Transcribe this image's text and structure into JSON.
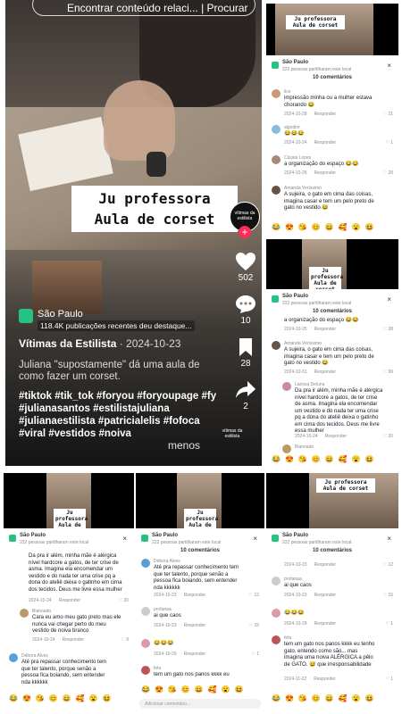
{
  "video": {
    "search_text": "Encontrar conteúdo relaci... | Procurar",
    "overlay_line1": "Ju professora",
    "overlay_line2": "Aula de corset",
    "avatar_text": "vítimas da estilista",
    "follow_symbol": "+",
    "likes": "502",
    "comments": "10",
    "saves": "28",
    "shares": "2",
    "location_name": "São Paulo",
    "location_sub": "118.4K publicações recentes deu destaque...",
    "author": "Vítimas da Estilista",
    "date": " · 2024-10-23",
    "description": "Juliana \"supostamente\" dá uma aula de como fazer um corset.",
    "hashtags": "#tiktok #tik_tok #foryou #foryoupage #fy #julianasantos #estilistajuliana #julianaestilista #patricialelis #fofoca #viral #vestidos #noiva",
    "less_label": "menos",
    "watermark": "vítimas da estilista",
    "accent": "#fe2c55"
  },
  "sheet": {
    "location": "São Paulo",
    "location_sub": "222 pessoas partilharam este local",
    "count_label": "10 comentários",
    "reply_label": "Responder",
    "close_symbol": "×",
    "add_placeholder": "Adicionar comentário...",
    "emojis": "😂😍😘😊😄🥰😮😆",
    "mini_overlay": "Ju professora Aula de corset"
  },
  "comments": {
    "c1": {
      "user": "lice",
      "text": "impressão minha ou a mulher estava chorando 😂",
      "date": "2024-10-28",
      "likes": "21"
    },
    "c2": {
      "user": "algodim",
      "text": "😂😂😂",
      "date": "2024-10-24",
      "likes": "1"
    },
    "c3": {
      "user": "Cássia Lopes",
      "text": "a organização do espaço 😂😂",
      "date": "2024-10-25",
      "likes": "28"
    },
    "c4": {
      "user": "Amanda Veríssimo",
      "text": "A sujeira, o gato em cima das coisas, imagina casar e tem um pelo preto de gato no vestido 😂",
      "date": "2024-10-31",
      "likes": "99"
    },
    "c5": {
      "user": "Larissa Deluna",
      "text": "Da pra ir além, minha mãe é alérgica nível hardcore a gatos, de ter crise de asma. Imagina ela encomendar um vestido e do nada ter uma crise pq a dona do ateliê deixa o gatinho em cima dos tecidos. Deus me livre essa mulher",
      "date": "2024-10-24",
      "likes": "20"
    },
    "c6": {
      "user": "Bianoado",
      "text": "Cara eu amo meu gato preto mas ele nunca vai chegar perto do meu vestido de noiva branco",
      "date": "2024-10-24",
      "likes": "9"
    },
    "c7": {
      "user": "Débora Alves",
      "text": "Até pra repassar conhecimento tem que ter talento, porque senão a pessoa fica boiando, sem entender nda kkkkkk",
      "date": "2024-10-23",
      "likes": "12"
    },
    "c8": {
      "user": "profanaa",
      "text": "ai que caos",
      "date": "2024-10-23",
      "likes": "15"
    },
    "c9": {
      "user": "",
      "text": "😂😂😂",
      "date": "2024-10-29",
      "likes": "1"
    },
    "c10": {
      "user": "fefa",
      "text": "tem um gato nos panos kkkk eu tenho gato, entendo como são... mas imagina uma noiva ALÉRGICA a pêlo de GATO. 😅 que irresponsabilidade",
      "date": "2024-11-22",
      "likes": "1"
    }
  }
}
